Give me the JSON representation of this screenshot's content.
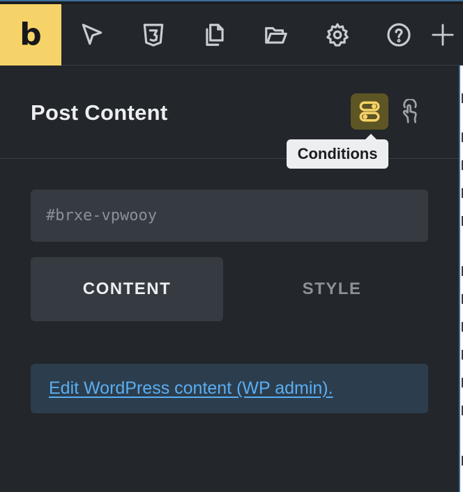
{
  "toolbar": {
    "logo": "b",
    "buttons": [
      {
        "icon": "cursor-icon"
      },
      {
        "icon": "css3-icon"
      },
      {
        "icon": "pages-icon"
      },
      {
        "icon": "folder-open-icon"
      },
      {
        "icon": "gear-icon"
      },
      {
        "icon": "help-icon"
      },
      {
        "icon": "plus-icon"
      }
    ]
  },
  "panel": {
    "title": "Post Content",
    "conditions_tooltip": "Conditions",
    "id_placeholder": "#brxe-vpwooy",
    "tabs": [
      {
        "label": "CONTENT",
        "active": true
      },
      {
        "label": "STYLE",
        "active": false
      }
    ],
    "notice_link": "Edit WordPress content (WP admin)."
  },
  "colors": {
    "accent": "#f5d368",
    "background": "#23262b",
    "link": "#5aaef2"
  }
}
